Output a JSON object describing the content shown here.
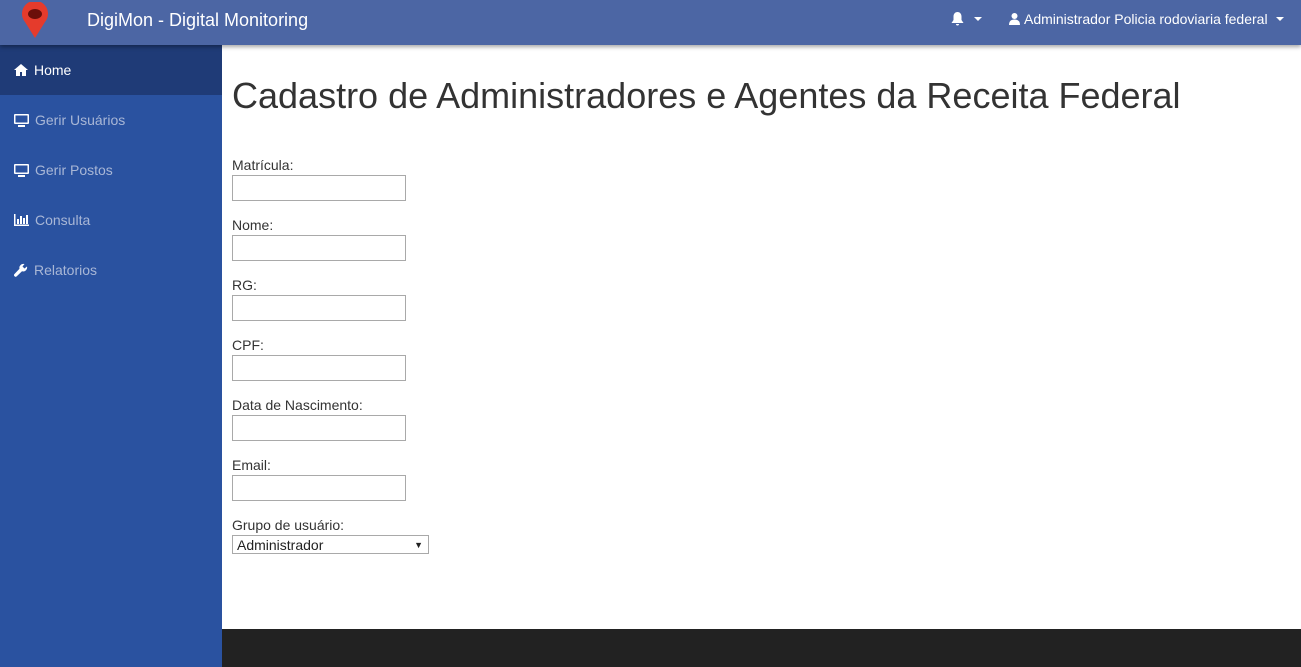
{
  "header": {
    "brand": "DigiMon - Digital Monitoring",
    "user": "Administrador Policia rodoviaria federal"
  },
  "sidebar": {
    "items": [
      {
        "label": "Home",
        "icon": "home-icon"
      },
      {
        "label": "Gerir Usuários",
        "icon": "monitor-icon"
      },
      {
        "label": "Gerir Postos",
        "icon": "monitor-icon"
      },
      {
        "label": "Consulta",
        "icon": "bar-chart-icon"
      },
      {
        "label": "Relatorios",
        "icon": "wrench-icon"
      }
    ]
  },
  "main": {
    "title": "Cadastro de Administradores e Agentes da Receita Federal",
    "fields": [
      "Matrícula:",
      "Nome:",
      "RG:",
      "CPF:",
      "Data de Nascimento:",
      "Email:"
    ],
    "group_label": "Grupo de usuário:",
    "group_value": "Administrador"
  }
}
